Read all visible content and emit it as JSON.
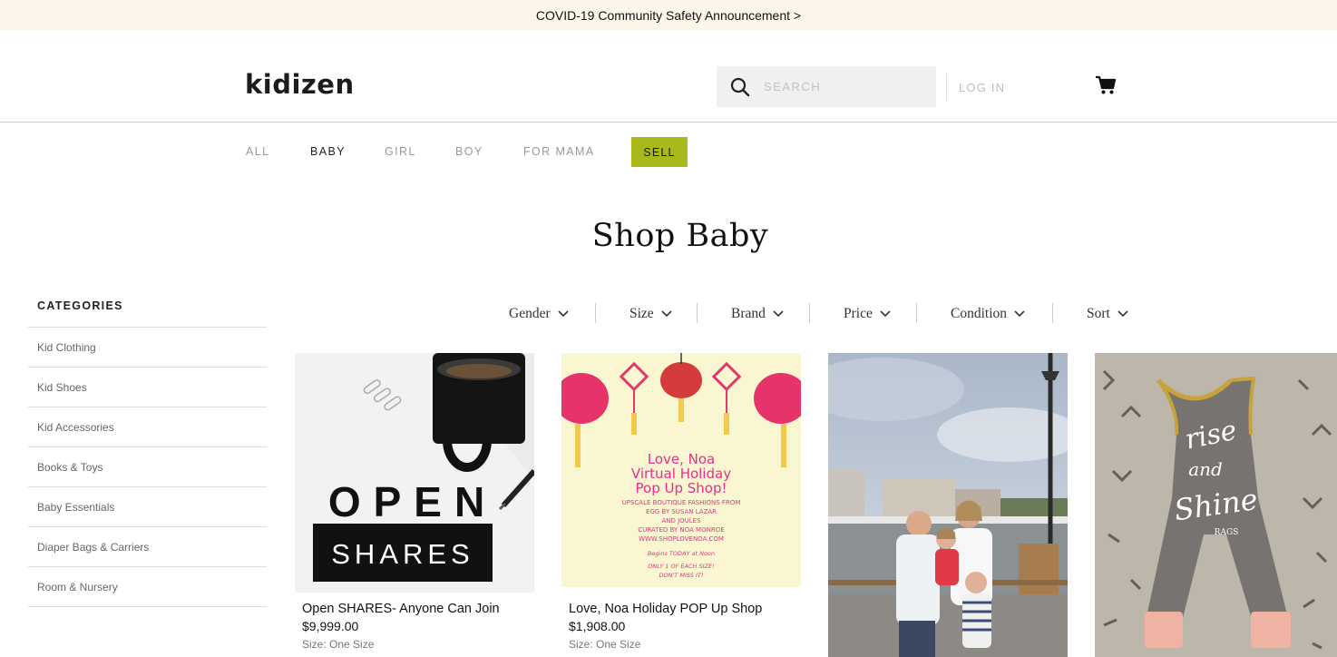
{
  "announcement": "COVID-19 Community Safety Announcement >",
  "header": {
    "logo": "kidizen",
    "search_placeholder": "SEARCH",
    "login": "LOG IN"
  },
  "nav": {
    "items": [
      "ALL",
      "BABY",
      "GIRL",
      "BOY",
      "FOR MAMA"
    ],
    "active": "BABY",
    "sell": "SELL"
  },
  "page_title": "Shop Baby",
  "sidebar": {
    "heading": "CATEGORIES",
    "items": [
      "Kid Clothing",
      "Kid Shoes",
      "Kid Accessories",
      "Books & Toys",
      "Baby Essentials",
      "Diaper Bags & Carriers",
      "Room & Nursery"
    ]
  },
  "filters": [
    "Gender",
    "Size",
    "Brand",
    "Price",
    "Condition",
    "Sort"
  ],
  "products": [
    {
      "name": "Open SHARES- Anyone Can Join",
      "price": "$9,999.00",
      "size": "Size: One Size",
      "image_text": [
        "OPEN",
        "SHARES"
      ]
    },
    {
      "name": "Love, Noa Holiday POP Up Shop",
      "price": "$1,908.00",
      "size": "Size: One Size",
      "image_text": [
        "Love, Noa",
        "Virtual Holiday",
        "Pop Up Shop!",
        "UPSCALE BOUTIQUE FASHIONS FROM",
        "EGG BY SUSAN LAZAR",
        "AND JOULES",
        "CURATED BY NOA MONROE",
        "WWW.SHOPLOVENOA.COM",
        "Begins TODAY at Noon",
        "ONLY 1 OF EACH SIZE!",
        "DON'T MISS IT!"
      ]
    },
    {
      "name": "",
      "price": "",
      "size": ""
    },
    {
      "name": "",
      "price": "",
      "size": "",
      "image_text": [
        "rise",
        "and",
        "Shine",
        "RAGS"
      ]
    }
  ],
  "colors": {
    "announcement_bg": "#fdf5e9",
    "sell_bg": "#a8b81d",
    "logo_heart": "#ef6b3b"
  }
}
